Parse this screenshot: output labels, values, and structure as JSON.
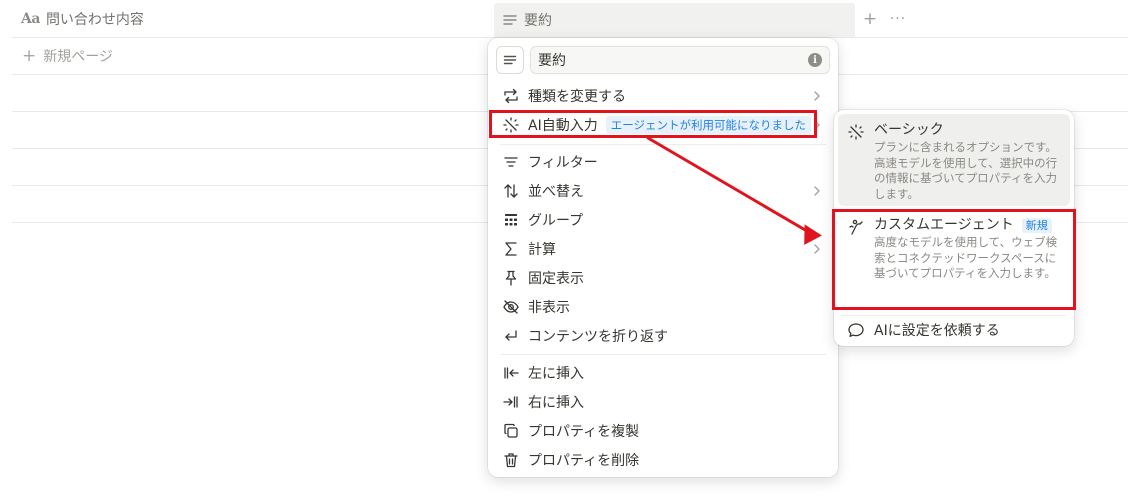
{
  "table": {
    "title_column": {
      "icon": "Aa",
      "label": "問い合わせ内容"
    },
    "summary_column": {
      "label": "要約"
    },
    "new_page_label": "新規ページ"
  },
  "menu": {
    "property_name": "要約",
    "info_icon": "i",
    "items": [
      {
        "label": "種類を変更する",
        "icon": "change-type-icon",
        "has_submenu": true
      },
      {
        "label": "AI自動入力",
        "badge": "エージェントが利用可能になりました",
        "icon": "sparkle-icon",
        "has_submenu": true
      },
      {
        "label": "フィルター",
        "icon": "filter-icon",
        "has_submenu": false
      },
      {
        "label": "並べ替え",
        "icon": "sort-icon",
        "has_submenu": true
      },
      {
        "label": "グループ",
        "icon": "group-icon",
        "has_submenu": false
      },
      {
        "label": "計算",
        "icon": "sigma-icon",
        "has_submenu": true
      },
      {
        "label": "固定表示",
        "icon": "pin-icon",
        "has_submenu": false
      },
      {
        "label": "非表示",
        "icon": "eye-off-icon",
        "has_submenu": false
      },
      {
        "label": "コンテンツを折り返す",
        "icon": "wrap-icon",
        "has_submenu": false
      },
      {
        "label": "左に挿入",
        "icon": "insert-left-icon",
        "has_submenu": false
      },
      {
        "label": "右に挿入",
        "icon": "insert-right-icon",
        "has_submenu": false
      },
      {
        "label": "プロパティを複製",
        "icon": "duplicate-icon",
        "has_submenu": false
      },
      {
        "label": "プロパティを削除",
        "icon": "trash-icon",
        "has_submenu": false
      }
    ]
  },
  "submenu": {
    "basic": {
      "title": "ベーシック",
      "description": "プランに含まれるオプションです。高速モデルを使用して、選択中の行の情報に基づいてプロパティを入力します。"
    },
    "custom_agent": {
      "title": "カスタムエージェント",
      "badge": "新規",
      "description": "高度なモデルを使用して、ウェブ検索とコネクテッドワークスペースに基づいてプロパティを入力します。"
    },
    "ask_ai_label": "AIに設定を依頼する"
  },
  "colors": {
    "highlight": "#e0131e",
    "accent_blue": "#2383e2",
    "badge_bg": "#e6f1fb",
    "text": "#37352f",
    "muted": "#8b8984"
  }
}
